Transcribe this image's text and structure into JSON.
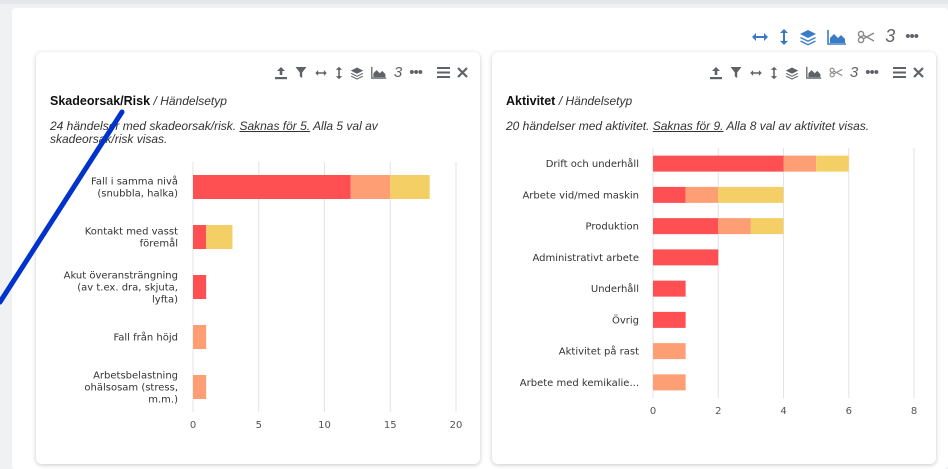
{
  "colors": {
    "red": "#fe4f52",
    "orange": "#fe9e75",
    "yellow": "#f3cf66",
    "accent": "#3a7bc8",
    "pointer": "#0033cc"
  },
  "toolbar": {
    "count": "3",
    "icons": [
      "arrows-horizontal-icon",
      "arrows-vertical-icon",
      "layers-icon",
      "area-chart-icon",
      "scissors-icon",
      "more-icon"
    ]
  },
  "cards": [
    {
      "title": "Skadeorsak/Risk",
      "subtitle": "/ Händelsetyp",
      "desc_pre": "24 händelser med skadeorsak/risk. ",
      "desc_link": "Saknas för 5.",
      "desc_post": " Alla 5 val av skadeorsak/risk visas.",
      "toolbar_count": "3",
      "chart_data": {
        "type": "bar",
        "orientation": "horizontal",
        "stacked": true,
        "categories": [
          [
            "Fall i samma nivå",
            "(snubbla, halka)"
          ],
          [
            "Kontakt med vasst",
            "föremål"
          ],
          [
            "Akut överansträngning",
            "(av t.ex. dra, skjuta,",
            "lyfta)"
          ],
          [
            "Fall från höjd"
          ],
          [
            "Arbetsbelastning",
            "ohälsosam (stress,",
            "m.m.)"
          ]
        ],
        "series": [
          {
            "color": "#fe4f52",
            "values": [
              12,
              1,
              1,
              0,
              0
            ]
          },
          {
            "color": "#fe9e75",
            "values": [
              3,
              0,
              0,
              1,
              1
            ]
          },
          {
            "color": "#f3cf66",
            "values": [
              3,
              2,
              0,
              0,
              0
            ]
          }
        ],
        "xlim": [
          0,
          20
        ],
        "xticks": [
          0,
          5,
          10,
          15,
          20
        ],
        "grid": true
      }
    },
    {
      "title": "Aktivitet",
      "subtitle": "/ Händelsetyp",
      "desc_pre": "20 händelser med aktivitet. ",
      "desc_link": "Saknas för 9.",
      "desc_post": " Alla 8 val av aktivitet visas.",
      "toolbar_count": "3",
      "chart_data": {
        "type": "bar",
        "orientation": "horizontal",
        "stacked": true,
        "categories": [
          [
            "Drift och underhåll"
          ],
          [
            "Arbete vid/med maskin"
          ],
          [
            "Produktion"
          ],
          [
            "Administrativt arbete"
          ],
          [
            "Underhåll"
          ],
          [
            "Övrig"
          ],
          [
            "Aktivitet på rast"
          ],
          [
            "Arbete med kemikalie..."
          ]
        ],
        "series": [
          {
            "color": "#fe4f52",
            "values": [
              4,
              1,
              2,
              2,
              1,
              1,
              0,
              0
            ]
          },
          {
            "color": "#fe9e75",
            "values": [
              1,
              1,
              1,
              0,
              0,
              0,
              1,
              1
            ]
          },
          {
            "color": "#f3cf66",
            "values": [
              1,
              2,
              1,
              0,
              0,
              0,
              0,
              0
            ]
          }
        ],
        "xlim": [
          0,
          8
        ],
        "xticks": [
          0,
          2,
          4,
          6,
          8
        ],
        "grid": true
      }
    }
  ]
}
